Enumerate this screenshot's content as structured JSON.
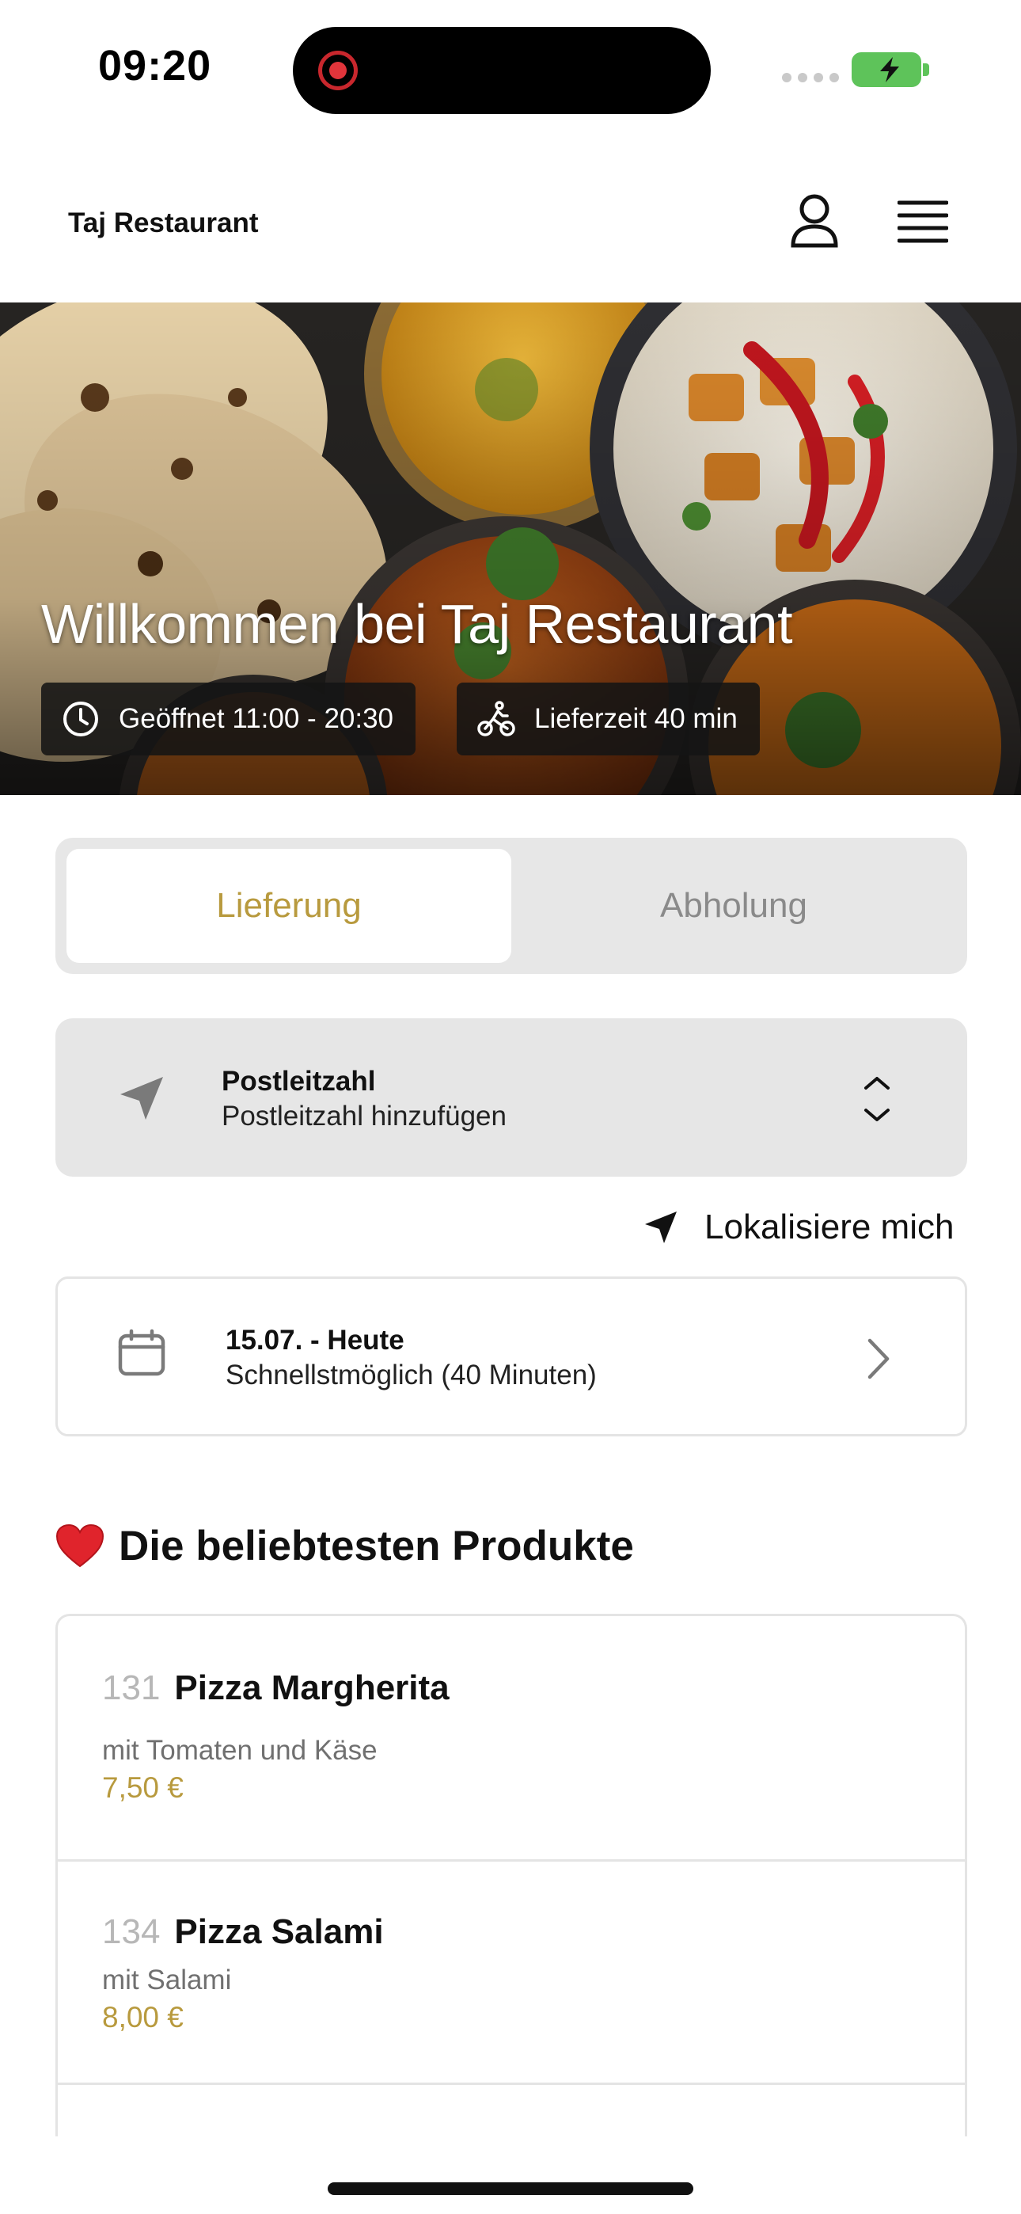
{
  "status_bar": {
    "time": "09:20",
    "icons": [
      "screen-recording-icon",
      "signal-icon",
      "battery-charging-icon"
    ],
    "battery_color": "#5ec35a",
    "recording_color": "#e0353b"
  },
  "header": {
    "title": "Taj Restaurant",
    "icons": [
      "account-icon",
      "menu-icon"
    ]
  },
  "hero": {
    "title": "Willkommen bei Taj Restaurant",
    "hours": "Geöffnet 11:00 - 20:30",
    "delivery_time": "Lieferzeit 40 min",
    "icons": [
      "clock-icon",
      "bicycle-icon"
    ]
  },
  "order_mode": {
    "options": [
      "Lieferung",
      "Abholung"
    ],
    "selected": "Lieferung",
    "accent_color": "#b89a3e"
  },
  "postal_code": {
    "label": "Postleitzahl",
    "placeholder": "Postleitzahl hinzufügen",
    "icons": [
      "location-arrow-icon",
      "chevron-up-down-icon"
    ]
  },
  "locate_me": {
    "label": "Lokalisiere mich",
    "icon": "location-arrow-icon"
  },
  "delivery_date": {
    "title": "15.07. - Heute",
    "subtitle": "Schnellstmöglich (40 Minuten)",
    "icons": [
      "calendar-icon",
      "chevron-right-icon"
    ]
  },
  "popular": {
    "emoji": "❤️",
    "title": "Die beliebtesten Produkte",
    "products": [
      {
        "number": "131",
        "name": "Pizza Margherita",
        "description": "mit Tomaten und Käse",
        "price": "7,50 €"
      },
      {
        "number": "134",
        "name": "Pizza Salami",
        "description": "mit Salami",
        "price": "8,00 €"
      }
    ]
  }
}
